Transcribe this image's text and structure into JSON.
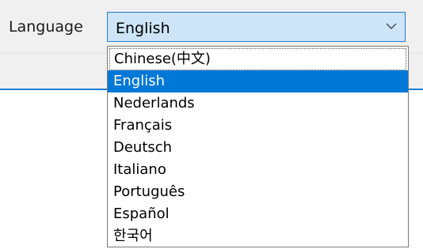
{
  "colors": {
    "accent": "#1f7fd1",
    "selection": "#0078d7",
    "combo_fill": "#cde5f7"
  },
  "language": {
    "label": "Language",
    "selected_value": "English",
    "dropdown_icon": "chevron-down-icon",
    "options": [
      "Chinese(中文)",
      "English",
      "Nederlands",
      "Français",
      "Deutsch",
      "Italiano",
      "Português",
      "Español",
      "한국어"
    ],
    "highlighted_option": "English"
  }
}
